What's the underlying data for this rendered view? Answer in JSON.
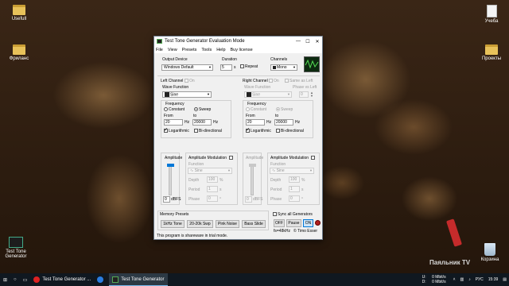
{
  "desktop": {
    "icons": [
      {
        "label": "Usefull"
      },
      {
        "label": "Фриланс"
      },
      {
        "label": "Учеба"
      },
      {
        "label": "Проекты"
      },
      {
        "label": "Test Tone Generator"
      },
      {
        "label": "Корзина"
      }
    ],
    "watermark": "Паяльник TV"
  },
  "window": {
    "title": "Test Tone Generator Evaluation Mode",
    "menu": [
      "File",
      "View",
      "Presets",
      "Tools",
      "Help",
      "Buy license"
    ],
    "output_device_label": "Output Device",
    "output_device_value": "Windows Default",
    "duration_label": "Duration",
    "duration_value": "5",
    "duration_unit": "s",
    "repeat_label": "Repeat",
    "channels_label": "Channels",
    "channels_value": "Mono",
    "left": {
      "channel_label": "Left Channel",
      "on_label": "On",
      "wave_function_label": "Wave Function",
      "wave_value": "Sine",
      "frequency_label": "Frequency",
      "constant_label": "Constant",
      "sweep_label": "Sweep",
      "from_label": "From",
      "from_value": "20",
      "to_label": "to",
      "to_value": "20000",
      "hz": "Hz",
      "logarithmic_label": "Logarithmic",
      "bidirectional_label": "Bi-directional",
      "amplitude_label": "Amplitude",
      "amp_mod_label": "Amplitude Modulation",
      "function_label": "Function",
      "function_value": "Sine",
      "depth_label": "Depth",
      "depth_value": "100",
      "depth_unit": "%",
      "period_label": "Period",
      "period_value": "1",
      "period_unit": "s",
      "phase_label": "Phase",
      "phase_value": "0",
      "phase_unit": "°",
      "dbfs_value": "0",
      "dbfs_label": "dBFS"
    },
    "right": {
      "channel_label": "Right Channel",
      "on_label": "On",
      "same_as_left_label": "Same as Left",
      "wave_function_label": "Wave Function",
      "phase_vs_left_label": "Phase vs Left",
      "phase_vs_left_value": "0",
      "wave_value": "Sine",
      "frequency_label": "Frequency",
      "constant_label": "Constant",
      "sweep_label": "Sweep",
      "from_label": "From",
      "from_value": "20",
      "to_label": "to",
      "to_value": "20000",
      "hz": "Hz",
      "logarithmic_label": "Logarithmic",
      "bidirectional_label": "Bi-directional",
      "amplitude_label": "Amplitude",
      "amp_mod_label": "Amplitude Modulation",
      "function_label": "Function",
      "function_value": "Sine",
      "depth_label": "Depth",
      "depth_value": "100",
      "depth_unit": "%",
      "period_label": "Period",
      "period_value": "1",
      "period_unit": "s",
      "phase_label": "Phase",
      "phase_value": "0",
      "phase_unit": "°",
      "dbfs_value": "0",
      "dbfs_label": "dBFS"
    },
    "memory_presets_label": "Memory Presets",
    "presets": [
      "1kHz Tone",
      "20-20k Swp",
      "Pink Noise",
      "Bass Slide"
    ],
    "sync_label": "Sync all Generators",
    "off_label": "OFF",
    "pause_label": "Pause",
    "on_button_label": "ON",
    "sample_rate": "fs=48kHz",
    "copyright": "© Timo Esser",
    "status": "This program is shareware in trial mode."
  },
  "taskbar": {
    "items": [
      {
        "label": "Test Tone Generator ..."
      },
      {
        "label": "Test Tone Generator"
      }
    ],
    "tray": {
      "upload_label": "U:",
      "upload_value": "0 Mbit/s",
      "download_label": "D:",
      "download_value": "0 Mbit/s",
      "lang": "РУС",
      "time": "15:39"
    }
  },
  "colors": {
    "accent": "#0078d7",
    "taskbar": "#101820",
    "scope_bg": "#0d2a10"
  }
}
